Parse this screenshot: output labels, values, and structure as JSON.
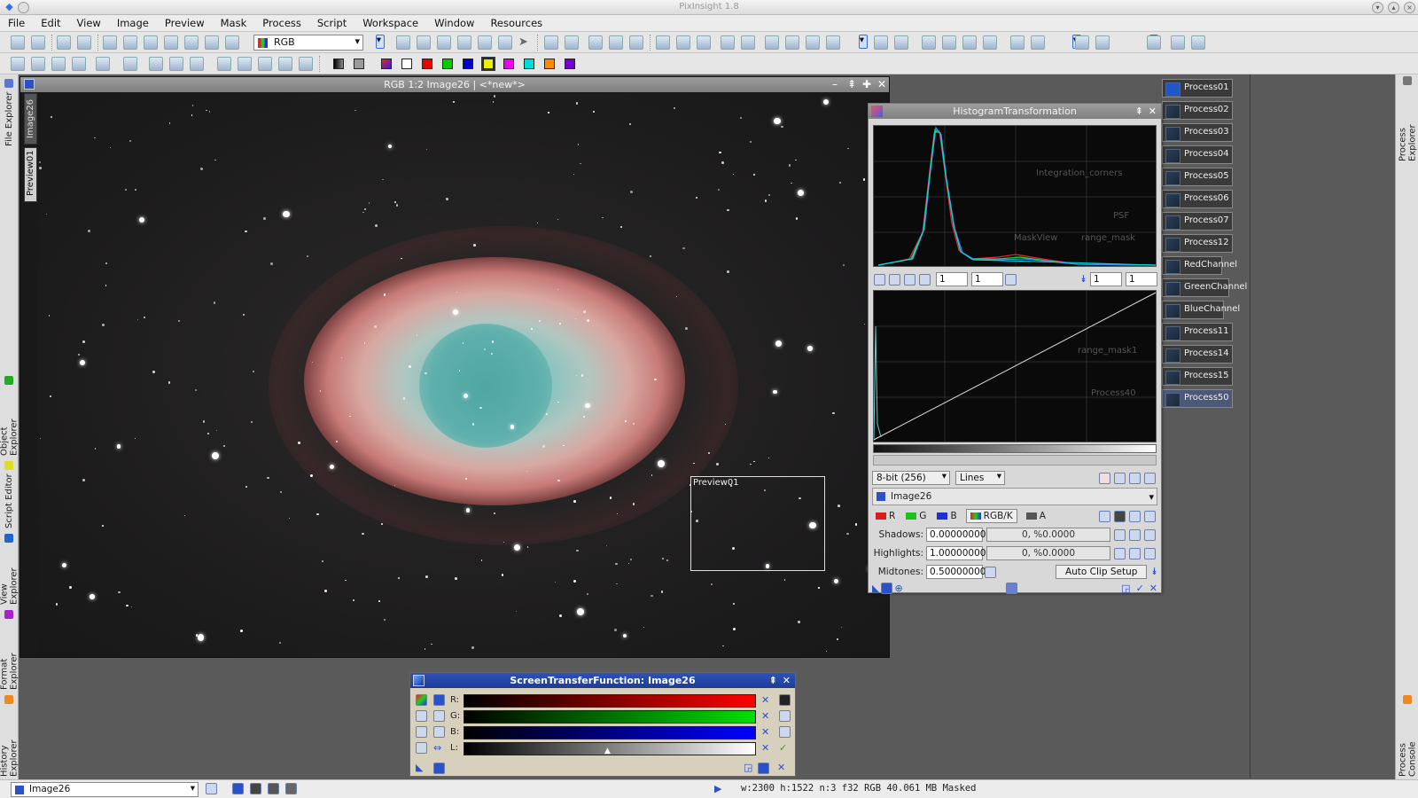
{
  "app": {
    "title": "PixInsight 1.8"
  },
  "menu": [
    "File",
    "Edit",
    "View",
    "Image",
    "Preview",
    "Mask",
    "Process",
    "Script",
    "Workspace",
    "Window",
    "Resources"
  ],
  "toolbar": {
    "color_space_select": "RGB"
  },
  "left_dock": {
    "tabs": [
      "File Explorer",
      "Object Explorer",
      "Script Editor",
      "View Explorer",
      "Format Explorer",
      "History Explorer"
    ]
  },
  "right_dock": {
    "tabs": [
      "Process Explorer",
      "Process Console"
    ]
  },
  "image_window": {
    "title": "RGB 1:2 Image26 | <*new*>",
    "view_tabs": [
      "Image26",
      "Preview01"
    ],
    "preview_label": "Preview01"
  },
  "histogram": {
    "title": "HistogramTransformation",
    "zoom_h": "1",
    "zoom_v": "1",
    "zoom_h2": "1",
    "zoom_v2": "1",
    "graph_style": "Lines",
    "resolution": "8-bit (256)",
    "view": "Image26",
    "channels": [
      {
        "label": "R",
        "color": "#d81e1e"
      },
      {
        "label": "G",
        "color": "#1fbf1f"
      },
      {
        "label": "B",
        "color": "#2030d0"
      },
      {
        "label": "RGB/K",
        "color": "#777777"
      },
      {
        "label": "A",
        "color": "#555555"
      }
    ],
    "shadows_label": "Shadows:",
    "shadows_value": "0.00000000",
    "shadows_clip": "0, %0.0000",
    "highlights_label": "Highlights:",
    "highlights_value": "1.00000000",
    "highlights_clip": "0, %0.0000",
    "midtones_label": "Midtones:",
    "midtones_value": "0.50000000",
    "auto_clip": "Auto Clip Setup",
    "ghost_labels": [
      "Integration_corners",
      "PSF",
      "MaskView",
      "range_mask",
      "range_mask1",
      "Process40"
    ]
  },
  "stf": {
    "title": "ScreenTransferFunction: Image26",
    "channels": [
      {
        "label": "R:",
        "from": "#000000",
        "to": "#ff0000"
      },
      {
        "label": "G:",
        "from": "#000000",
        "to": "#00e000"
      },
      {
        "label": "B:",
        "from": "#000000",
        "to": "#0000ff"
      },
      {
        "label": "L:",
        "from": "#000000",
        "to": "#ffffff"
      }
    ]
  },
  "process_icons": [
    "Process01",
    "Process02",
    "Process03",
    "Process04",
    "Process05",
    "Process06",
    "Process07",
    "Process12",
    "RedChannel",
    "GreenChannel",
    "BlueChannel",
    "Process11",
    "Process14",
    "Process15",
    "Process50"
  ],
  "status": {
    "view": "Image26",
    "info": "w:2300  h:1522  n:3  f32  RGB  40.061 MB  Masked"
  }
}
